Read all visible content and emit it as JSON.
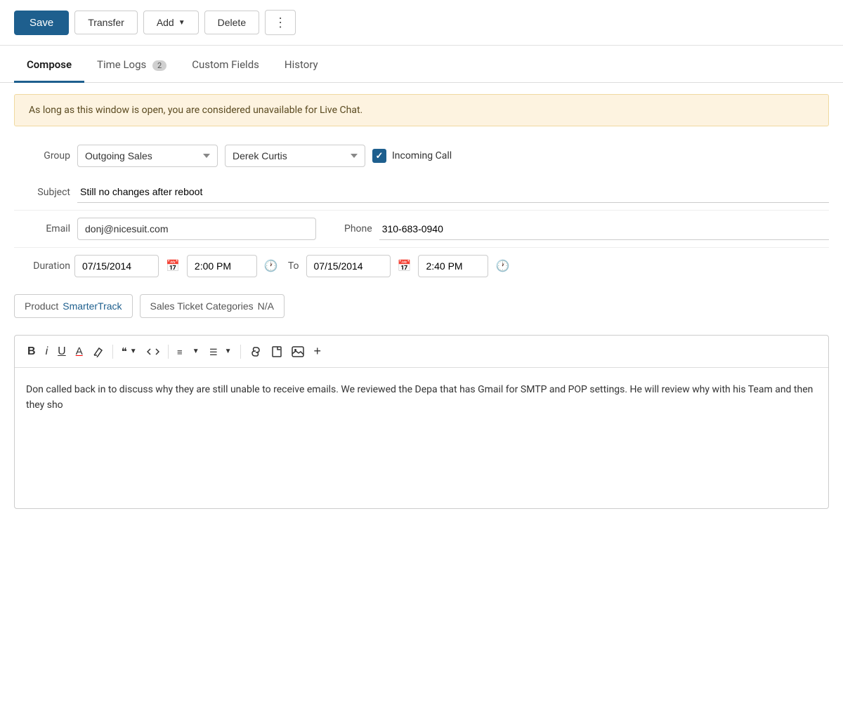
{
  "toolbar": {
    "save_label": "Save",
    "transfer_label": "Transfer",
    "add_label": "Add",
    "delete_label": "Delete",
    "more_label": "⋮"
  },
  "tabs": [
    {
      "id": "compose",
      "label": "Compose",
      "active": true,
      "badge": null
    },
    {
      "id": "time-logs",
      "label": "Time Logs",
      "active": false,
      "badge": "2"
    },
    {
      "id": "custom-fields",
      "label": "Custom Fields",
      "active": false,
      "badge": null
    },
    {
      "id": "history",
      "label": "History",
      "active": false,
      "badge": null
    }
  ],
  "alert": {
    "message": "As long as this window is open, you are considered unavailable for Live Chat."
  },
  "form": {
    "group_label": "Group",
    "group_value": "Outgoing Sales",
    "agent_value": "Derek Curtis",
    "incoming_call_label": "Incoming Call",
    "subject_label": "Subject",
    "subject_value": "Still no changes after reboot",
    "email_label": "Email",
    "email_value": "donj@nicesuit.com",
    "phone_label": "Phone",
    "phone_value": "310-683-0940",
    "duration_label": "Duration",
    "date_start": "07/15/2014",
    "time_start": "2:00 PM",
    "to_label": "To",
    "date_end": "07/15/2014",
    "time_end": "2:40 PM",
    "product_label": "Product",
    "product_value": "SmarterTrack",
    "category_label": "Sales Ticket Categories",
    "category_value": "N/A"
  },
  "editor": {
    "body_text": "Don called back in to discuss why they are still unable to receive emails. We reviewed the Depa that has Gmail for SMTP and POP settings. He will review why with his Team and then they sho"
  },
  "icons": {
    "calendar": "📅",
    "clock": "🕐",
    "bold": "B",
    "italic": "i",
    "underline": "U",
    "font_color": "A",
    "eraser": "✏",
    "blockquote": "❝",
    "code": "</>",
    "ordered_list": "≡",
    "unordered_list": "☰",
    "link": "🔗",
    "file": "📄",
    "image": "🖼",
    "plus": "+"
  }
}
